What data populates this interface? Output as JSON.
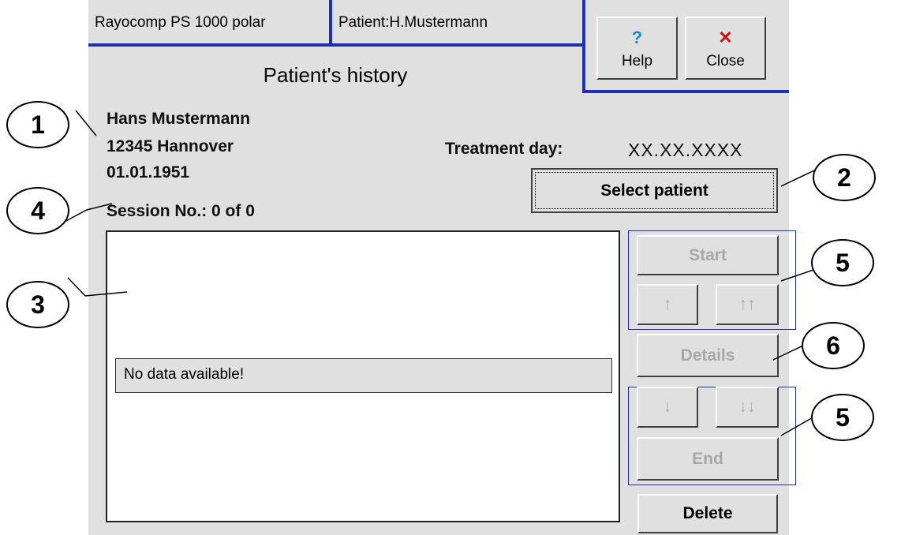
{
  "header": {
    "device_tab": "Rayocomp PS 1000 polar",
    "patient_tab": "Patient:H.Mustermann",
    "help": {
      "icon": "question-icon",
      "label": "Help",
      "icon_color": "#1a8ccc"
    },
    "close": {
      "icon": "close-icon",
      "label": "Close",
      "icon_color": "#cc1111"
    }
  },
  "title": "Patient's history",
  "patient": {
    "name": "Hans Mustermann",
    "city": "12345 Hannover",
    "birthdate": "01.01.1951",
    "session": "Session No.: 0 of 0"
  },
  "treatment": {
    "label": "Treatment day:",
    "value": "XX.XX.XXXX"
  },
  "buttons": {
    "select_patient": "Select patient",
    "start": "Start",
    "up": "↑",
    "up_double": "↑↑",
    "details": "Details",
    "down": "↓",
    "down_double": "↓↓",
    "end": "End",
    "delete": "Delete"
  },
  "list": {
    "empty_message": "No data available!"
  },
  "callouts": {
    "c1": "1",
    "c2": "2",
    "c3": "3",
    "c4": "4",
    "c5a": "5",
    "c5b": "5",
    "c6": "6"
  },
  "colors": {
    "accent": "#1c2fb5",
    "panel": "#e0e0e0",
    "disabled_text": "#a8a8a8"
  }
}
